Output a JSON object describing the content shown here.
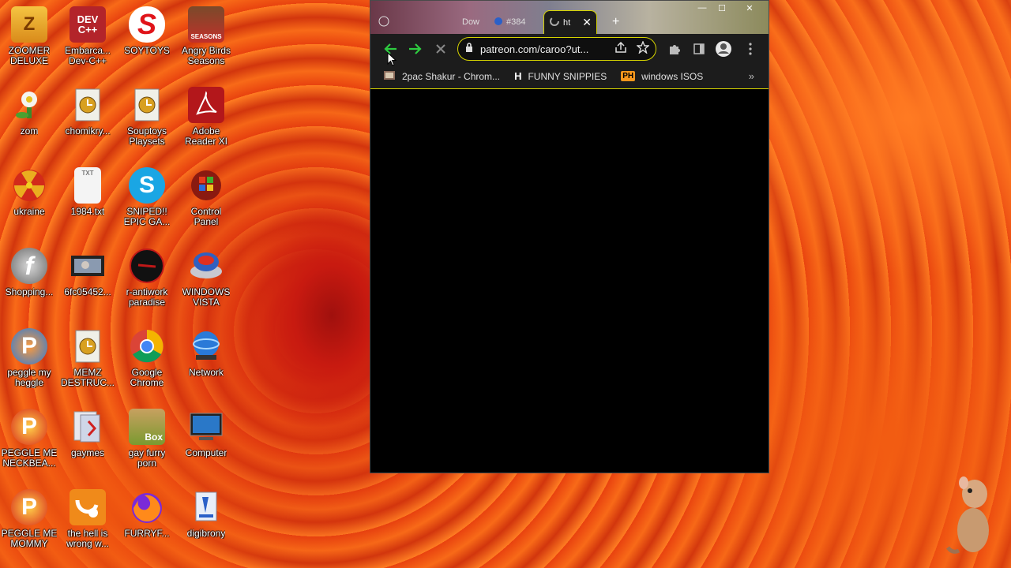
{
  "desktop": {
    "icons": [
      {
        "label": "ZOOMER\nDELUXE",
        "art": "Z"
      },
      {
        "label": "Embarca...\nDev-C++",
        "art": "DEV\nC++"
      },
      {
        "label": "SOYTOYS",
        "art": "S"
      },
      {
        "label": "Angry Birds\nSeasons",
        "art": "SEASONS"
      },
      {
        "label": "zom",
        "art": ""
      },
      {
        "label": "chomikry...",
        "art": ""
      },
      {
        "label": "Souptoys\nPlaysets",
        "art": ""
      },
      {
        "label": "Adobe\nReader XI",
        "art": ""
      },
      {
        "label": "ukraine",
        "art": ""
      },
      {
        "label": "1984.txt",
        "art": "TXT"
      },
      {
        "label": "SNIPED!!\nEPIC GA...",
        "art": "S"
      },
      {
        "label": "Control\nPanel",
        "art": ""
      },
      {
        "label": "Shopping...",
        "art": "f"
      },
      {
        "label": "6fc05452...",
        "art": ""
      },
      {
        "label": "r-antiwork\nparadise",
        "art": ""
      },
      {
        "label": "WINDOWS\nVISTA",
        "art": ""
      },
      {
        "label": "peggle my\nheggle",
        "art": "P"
      },
      {
        "label": "MEMZ\nDESTRUC...",
        "art": ""
      },
      {
        "label": "Google\nChrome",
        "art": ""
      },
      {
        "label": "Network",
        "art": ""
      },
      {
        "label": "PEGGLE ME\nNECKBEA...",
        "art": "P"
      },
      {
        "label": "gaymes",
        "art": ""
      },
      {
        "label": "gay furry\nporn",
        "art": "Box"
      },
      {
        "label": "Computer",
        "art": ""
      },
      {
        "label": "PEGGLE ME\nMOMMY",
        "art": "P"
      },
      {
        "label": "the hell is\nwrong w...",
        "art": ""
      },
      {
        "label": "FURRYF...",
        "art": ""
      },
      {
        "label": "digibrony",
        "art": ""
      }
    ]
  },
  "browser": {
    "tabs": [
      {
        "label": "Dow"
      },
      {
        "label": "#384"
      },
      {
        "label": "ht",
        "active": true
      }
    ],
    "url": "patreon.com/caroo?ut...",
    "bookmarks": [
      {
        "label": "2pac Shakur - Chrom...",
        "icon": ""
      },
      {
        "label": "FUNNY SNIPPIES",
        "icon": "H"
      },
      {
        "label": "windows ISOS",
        "icon": "PH"
      }
    ],
    "overflow": "»"
  },
  "colors": {
    "accent": "#d6d400",
    "nav_green": "#2ecc40",
    "browser_bg": "#1c1c1c"
  }
}
